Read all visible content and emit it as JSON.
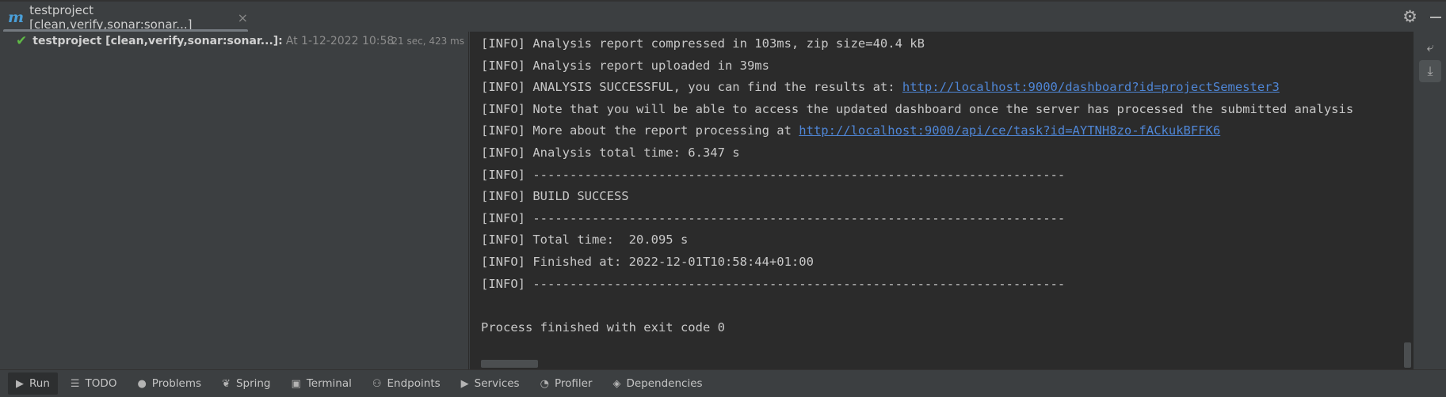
{
  "run_tab": {
    "icon": "maven-m-icon",
    "label": "testproject [clean,verify,sonar:sonar...]",
    "close_glyph": "×"
  },
  "tree": {
    "status_icon": "check-icon",
    "title": "testproject [clean,verify,sonar:sonar...]:",
    "timestamp": "At 1-12-2022 10:58",
    "duration": "21 sec, 423 ms"
  },
  "console": {
    "lines": [
      {
        "text": "[INFO] Analysis report compressed in 103ms, zip size=40.4 kB"
      },
      {
        "text": "[INFO] Analysis report uploaded in 39ms"
      },
      {
        "text": "[INFO] ANALYSIS SUCCESSFUL, you can find the results at: ",
        "link": "http://localhost:9000/dashboard?id=projectSemester3"
      },
      {
        "text": "[INFO] Note that you will be able to access the updated dashboard once the server has processed the submitted analysis"
      },
      {
        "text": "[INFO] More about the report processing at ",
        "link": "http://localhost:9000/api/ce/task?id=AYTNH8zo-fACkukBFFK6"
      },
      {
        "text": "[INFO] Analysis total time: 6.347 s"
      },
      {
        "text": "[INFO] ------------------------------------------------------------------------"
      },
      {
        "text": "[INFO] BUILD SUCCESS"
      },
      {
        "text": "[INFO] ------------------------------------------------------------------------"
      },
      {
        "text": "[INFO] Total time:  20.095 s"
      },
      {
        "text": "[INFO] Finished at: 2022-12-01T10:58:44+01:00"
      },
      {
        "text": "[INFO] ------------------------------------------------------------------------"
      },
      {
        "text": ""
      },
      {
        "text": "Process finished with exit code 0"
      }
    ]
  },
  "bottom_tabs": [
    {
      "label": "Run",
      "icon": "play-icon",
      "glyph": "▶",
      "active": true
    },
    {
      "label": "TODO",
      "icon": "list-icon",
      "glyph": "☰",
      "active": false
    },
    {
      "label": "Problems",
      "icon": "problems-icon",
      "glyph": "●",
      "active": false
    },
    {
      "label": "Spring",
      "icon": "spring-leaf-icon",
      "glyph": "❦",
      "active": false
    },
    {
      "label": "Terminal",
      "icon": "terminal-icon",
      "glyph": "▣",
      "active": false
    },
    {
      "label": "Endpoints",
      "icon": "endpoints-icon",
      "glyph": "⚇",
      "active": false
    },
    {
      "label": "Services",
      "icon": "services-icon",
      "glyph": "▶",
      "active": false
    },
    {
      "label": "Profiler",
      "icon": "profiler-icon",
      "glyph": "◔",
      "active": false
    },
    {
      "label": "Dependencies",
      "icon": "dependencies-icon",
      "glyph": "◈",
      "active": false
    }
  ],
  "colors": {
    "link": "#4f86d6",
    "success": "#5fb946",
    "console_bg": "#2b2b2b",
    "panel_bg": "#3c3f41"
  }
}
